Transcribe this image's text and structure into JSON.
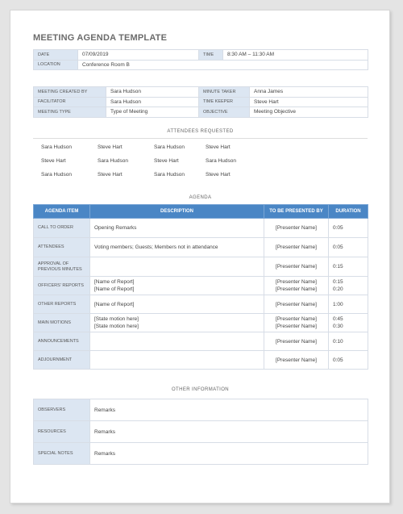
{
  "title": "MEETING AGENDA TEMPLATE",
  "meeting": {
    "date_label": "DATE",
    "date": "07/09/2019",
    "time_label": "TIME",
    "time": "8:30 AM – 11:30 AM",
    "location_label": "LOCATION",
    "location": "Conference Room B"
  },
  "roles": {
    "created_by_label": "MEETING CREATED BY",
    "created_by": "Sara Hudson",
    "minute_taker_label": "MINUTE TAKER",
    "minute_taker": "Anna James",
    "facilitator_label": "FACILITATOR",
    "facilitator": "Sara Hudson",
    "time_keeper_label": "TIME KEEPER",
    "time_keeper": "Steve Hart",
    "type_label": "MEETING TYPE",
    "type": "Type of Meeting",
    "objective_label": "OBJECTIVE",
    "objective": "Meeting Objective"
  },
  "attendees": {
    "heading": "ATTENDEES REQUESTED",
    "rows": [
      [
        "Sara Hudson",
        "Steve Hart",
        "Sara Hudson",
        "Steve Hart"
      ],
      [
        "Steve Hart",
        "Sara Hudson",
        "Steve Hart",
        "Sara Hudson"
      ],
      [
        "Sara Hudson",
        "Steve Hart",
        "Sara Hudson",
        "Steve Hart"
      ]
    ]
  },
  "agenda": {
    "heading": "AGENDA",
    "columns": [
      "AGENDA ITEM",
      "DESCRIPTION",
      "TO BE PRESENTED BY",
      "DURATION"
    ],
    "rows": [
      {
        "item": "CALL TO ORDER",
        "desc": [
          "Opening Remarks"
        ],
        "presenter": [
          "[Presenter Name]"
        ],
        "duration": [
          "0:05"
        ]
      },
      {
        "item": "ATTENDEES",
        "desc": [
          "Voting members; Guests; Members not in attendance"
        ],
        "presenter": [
          "[Presenter Name]"
        ],
        "duration": [
          "0:05"
        ]
      },
      {
        "item": "APPROVAL OF PREVIOUS MINUTES",
        "desc": [
          ""
        ],
        "presenter": [
          "[Presenter Name]"
        ],
        "duration": [
          "0:15"
        ]
      },
      {
        "item": "OFFICERS' REPORTS",
        "desc": [
          "[Name of Report]",
          "[Name of Report]"
        ],
        "presenter": [
          "[Presenter Name]",
          "[Presenter Name]"
        ],
        "duration": [
          "0:15",
          "0:20"
        ]
      },
      {
        "item": "OTHER REPORTS",
        "desc": [
          "[Name of Report]"
        ],
        "presenter": [
          "[Presenter Name]"
        ],
        "duration": [
          "1:00"
        ]
      },
      {
        "item": "MAIN MOTIONS",
        "desc": [
          "[State motion here]",
          "[State motion here]"
        ],
        "presenter": [
          "[Presenter Name]",
          "[Presenter Name]"
        ],
        "duration": [
          "0:45",
          "0:30"
        ]
      },
      {
        "item": "ANNOUNCEMENTS",
        "desc": [
          ""
        ],
        "presenter": [
          "[Presenter Name]"
        ],
        "duration": [
          "0:10"
        ]
      },
      {
        "item": "ADJOURNMENT",
        "desc": [
          ""
        ],
        "presenter": [
          "[Presenter Name]"
        ],
        "duration": [
          "0:05"
        ]
      }
    ]
  },
  "other_info": {
    "heading": "OTHER INFORMATION",
    "rows": [
      {
        "label": "OBSERVERS",
        "value": "Remarks"
      },
      {
        "label": "RESOURCES",
        "value": "Remarks"
      },
      {
        "label": "SPECIAL NOTES",
        "value": "Remarks"
      }
    ]
  },
  "colors": {
    "header_blue": "#4a86c5",
    "label_bg": "#dce6f2",
    "title_gray": "#6b6b6b"
  }
}
